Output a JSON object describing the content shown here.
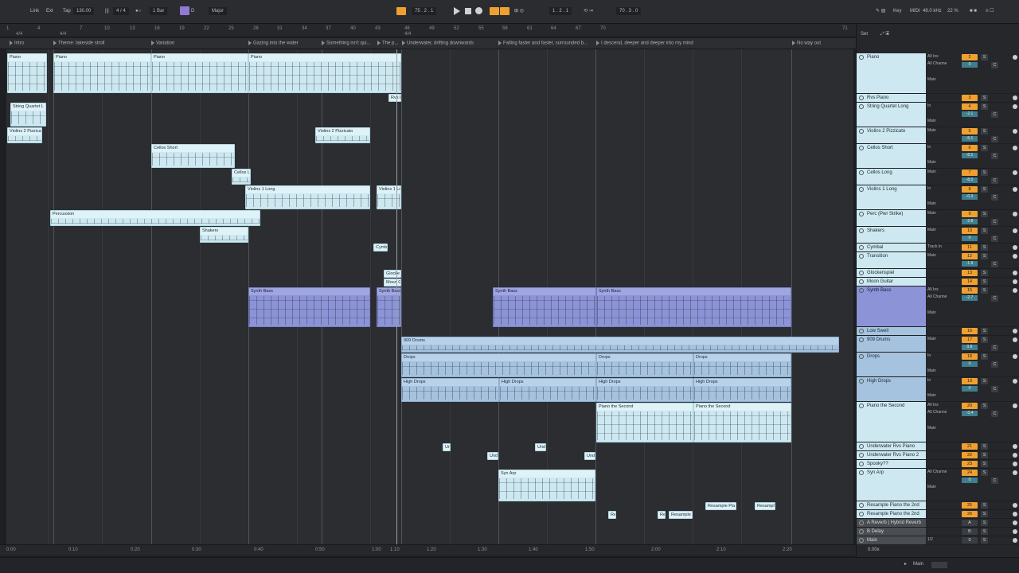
{
  "transport": {
    "link": "Link",
    "ext": "Ext",
    "tap": "Tap",
    "tempo": "130.00",
    "signature": "4 / 4",
    "quantize": "1 Bar",
    "key": "D",
    "scale": "Major",
    "position": "75 . 2 . 1",
    "loop_start": "1 . 2 . 1",
    "loop_length": "70 . 3 . 0",
    "key_label": "Key",
    "midi_label": "MIDI",
    "sample_rate": "48.0 kHz",
    "cpu": "22 %"
  },
  "ruler": {
    "bars": [
      "1",
      "4",
      "7",
      "10",
      "13",
      "16",
      "19",
      "22",
      "25",
      "28",
      "31",
      "34",
      "37",
      "40",
      "43",
      "46",
      "49",
      "52",
      "55",
      "58",
      "61",
      "64",
      "67",
      "70",
      "71"
    ],
    "signatures": [
      {
        "label": "4/4"
      },
      {
        "label": "4/4"
      },
      {
        "label": "4/4"
      }
    ]
  },
  "locators": [
    {
      "label": "Intro"
    },
    {
      "label": "Theme: lakeside stroll"
    },
    {
      "label": "Variation"
    },
    {
      "label": "Gazing into the water"
    },
    {
      "label": "Something isn't qui..."
    },
    {
      "label": "The p..."
    },
    {
      "label": "Underwater, drifting downwards"
    },
    {
      "label": "Falling faster and faster, surrounded b..."
    },
    {
      "label": "I descend, deeper and deeper into my mind"
    },
    {
      "label": "No way out"
    }
  ],
  "clips": [
    {
      "label": "Piano"
    },
    {
      "label": "Piano"
    },
    {
      "label": "Piano"
    },
    {
      "label": "Piano"
    },
    {
      "label": "Rvs P"
    },
    {
      "label": "String Quartet L"
    },
    {
      "label": "Violins 2 Pizzica"
    },
    {
      "label": "Violins 2 Pizzicato"
    },
    {
      "label": "Cellos Short"
    },
    {
      "label": "Cellos Lo"
    },
    {
      "label": "Violins 1 Long"
    },
    {
      "label": "Violins 1 Lo"
    },
    {
      "label": "Percussion"
    },
    {
      "label": "Shakers"
    },
    {
      "label": "Cymba"
    },
    {
      "label": "Glocke"
    },
    {
      "label": "Moon G"
    },
    {
      "label": "Synth Bass"
    },
    {
      "label": "Synth Bass"
    },
    {
      "label": "Synth Bass"
    },
    {
      "label": "Synth Bass"
    },
    {
      "label": "909 Drums"
    },
    {
      "label": "Drops"
    },
    {
      "label": "Drops"
    },
    {
      "label": "Drops"
    },
    {
      "label": "High Drops"
    },
    {
      "label": "High Drops"
    },
    {
      "label": "High Drops"
    },
    {
      "label": "High Drops"
    },
    {
      "label": "Piano the Second"
    },
    {
      "label": "Piano the Second"
    },
    {
      "label": "Un"
    },
    {
      "label": "Unde"
    },
    {
      "label": "Und"
    },
    {
      "label": "Unde"
    },
    {
      "label": "Syn Arp"
    },
    {
      "label": "Resample Pia"
    },
    {
      "label": "Resampl"
    },
    {
      "label": "Res"
    },
    {
      "label": "Res"
    },
    {
      "label": "Resample"
    }
  ],
  "timeline": [
    "0:00",
    "0:10",
    "0:20",
    "0:30",
    "0:40",
    "0:50",
    "1:00",
    "1:10",
    "1:20",
    "1:30",
    "1:40",
    "1:50",
    "2:00",
    "2:10",
    "2:20"
  ],
  "mixer": {
    "set_label": "Set",
    "tracks": [
      {
        "name": "Piano",
        "input": "All Ins",
        "chan": "All Channe",
        "out": "Main",
        "num": "2",
        "vol": "0",
        "pan": "C"
      },
      {
        "name": "Rvs Piano",
        "input": "",
        "chan": "",
        "out": "",
        "num": "3",
        "vol": "",
        "pan": ""
      },
      {
        "name": "String Quartet Long",
        "input": "In",
        "chan": "",
        "out": "Main",
        "num": "4",
        "vol": "-2.1",
        "pan": "C"
      },
      {
        "name": "Violins 2 Pizzicato",
        "input": "Main",
        "chan": "",
        "out": "",
        "num": "5",
        "vol": "-5.1",
        "pan": "C"
      },
      {
        "name": "Cellos Short",
        "input": "In",
        "chan": "",
        "out": "Main",
        "num": "6",
        "vol": "-6.1",
        "pan": "C"
      },
      {
        "name": "Cellos Long",
        "input": "Main",
        "chan": "",
        "out": "",
        "num": "7",
        "vol": "-8.0",
        "pan": "C"
      },
      {
        "name": "Violins 1 Long",
        "input": "In",
        "chan": "",
        "out": "Main",
        "num": "8",
        "vol": "-0.3",
        "pan": "C"
      },
      {
        "name": "Perc (Pwr Strike)",
        "input": "Main",
        "chan": "",
        "out": "",
        "num": "9",
        "vol": "-2.8",
        "pan": "C"
      },
      {
        "name": "Shakers",
        "input": "Main",
        "chan": "",
        "out": "",
        "num": "10",
        "vol": "0",
        "pan": "C"
      },
      {
        "name": "Cymbal",
        "input": "Track In",
        "chan": "",
        "out": "",
        "num": "11",
        "vol": "",
        "pan": ""
      },
      {
        "name": "Transition",
        "input": "Main",
        "chan": "",
        "out": "",
        "num": "12",
        "vol": "-1.9",
        "pan": "C"
      },
      {
        "name": "Glockenspiel",
        "input": "",
        "chan": "",
        "out": "",
        "num": "13",
        "vol": "",
        "pan": ""
      },
      {
        "name": "Moon Guitar",
        "input": "",
        "chan": "",
        "out": "",
        "num": "14",
        "vol": "",
        "pan": ""
      },
      {
        "name": "Synth Bass",
        "input": "All Ins",
        "chan": "All Channe",
        "out": "Main",
        "num": "15",
        "vol": "-2.7",
        "pan": "C"
      },
      {
        "name": "Low Swell",
        "input": "",
        "chan": "",
        "out": "",
        "num": "16",
        "vol": "",
        "pan": ""
      },
      {
        "name": "909 Drums",
        "input": "Main",
        "chan": "",
        "out": "",
        "num": "17",
        "vol": "0.8",
        "pan": "C"
      },
      {
        "name": "Drops",
        "input": "In",
        "chan": "",
        "out": "Main",
        "num": "18",
        "vol": "0",
        "pan": "C"
      },
      {
        "name": "High Drops",
        "input": "In",
        "chan": "",
        "out": "Main",
        "num": "19",
        "vol": "0",
        "pan": "C"
      },
      {
        "name": "Piano the Second",
        "input": "All Ins",
        "chan": "All Channe",
        "out": "Main",
        "num": "20",
        "vol": "-3.4",
        "pan": "C"
      },
      {
        "name": "Underwater Rvs Piano",
        "input": "",
        "chan": "",
        "out": "",
        "num": "21",
        "vol": "",
        "pan": ""
      },
      {
        "name": "Underwater Rvs Piano 2",
        "input": "",
        "chan": "",
        "out": "",
        "num": "22",
        "vol": "",
        "pan": ""
      },
      {
        "name": "Spooky??",
        "input": "",
        "chan": "",
        "out": "",
        "num": "23",
        "vol": "",
        "pan": ""
      },
      {
        "name": "Syn Arp",
        "input": "All Channe",
        "chan": "",
        "out": "Main",
        "num": "24",
        "vol": "0",
        "pan": "C"
      },
      {
        "name": "Resample Piano the 2nd",
        "input": "",
        "chan": "",
        "out": "",
        "num": "25",
        "vol": "",
        "pan": ""
      },
      {
        "name": "Resample Piano the 2nd",
        "input": "",
        "chan": "",
        "out": "",
        "num": "26",
        "vol": "",
        "pan": ""
      },
      {
        "name": "A Reverb | Hybrid Reverb",
        "input": "",
        "chan": "",
        "out": "",
        "num": "A",
        "vol": "",
        "pan": ""
      },
      {
        "name": "B Delay",
        "input": "",
        "chan": "",
        "out": "",
        "num": "B",
        "vol": "",
        "pan": ""
      },
      {
        "name": "Main",
        "input": "1/2",
        "chan": "",
        "out": "",
        "num": "0",
        "vol": "",
        "pan": ""
      }
    ],
    "zoom": "0.00x"
  },
  "status": {
    "main": "Main"
  },
  "colors": {
    "accent": "#f0a030",
    "clip_light": "#cde8f0",
    "clip_purple": "#8c93d6",
    "clip_blue": "#a5c2de"
  }
}
